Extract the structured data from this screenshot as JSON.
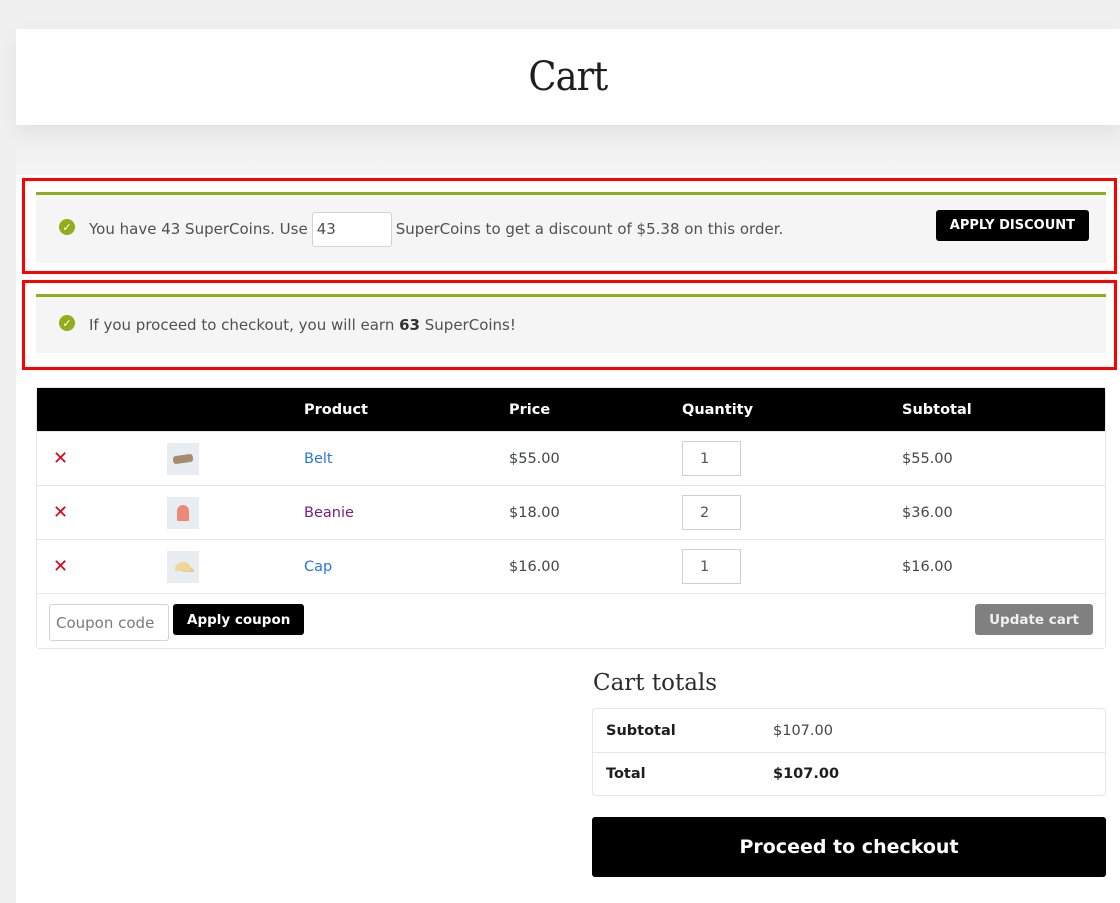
{
  "page": {
    "title": "Cart"
  },
  "supercoins_notice": {
    "text_before": "You have 43 SuperCoins. Use",
    "input_value": "43",
    "text_after": "SuperCoins to get a discount of $5.38 on this order.",
    "apply_label": "APPLY DISCOUNT",
    "icon": "check-circle-icon"
  },
  "earn_notice": {
    "text_before": "If you proceed to checkout, you will earn",
    "amount": "63",
    "text_after": "SuperCoins!",
    "icon": "check-circle-icon"
  },
  "colors": {
    "accent_green": "#8fae1b",
    "highlight_red": "#ff0000",
    "remove_red": "#e2001a",
    "link_blue": "#2a78d3",
    "link_visited": "#7b1c84"
  },
  "cart_table": {
    "headers": [
      "",
      "",
      "Product",
      "Price",
      "Quantity",
      "Subtotal"
    ],
    "rows": [
      {
        "name": "Belt",
        "price": "$55.00",
        "qty": "1",
        "subtotal": "$55.00",
        "thumb": "belt"
      },
      {
        "name": "Beanie",
        "price": "$18.00",
        "qty": "2",
        "subtotal": "$36.00",
        "thumb": "beanie"
      },
      {
        "name": "Cap",
        "price": "$16.00",
        "qty": "1",
        "subtotal": "$16.00",
        "thumb": "cap"
      }
    ],
    "remove_icon": "✕",
    "coupon_placeholder": "Coupon code",
    "apply_coupon_label": "Apply coupon",
    "update_cart_label": "Update cart"
  },
  "cart_totals": {
    "title": "Cart totals",
    "subtotal_label": "Subtotal",
    "subtotal_value": "$107.00",
    "total_label": "Total",
    "total_value": "$107.00",
    "checkout_label": "Proceed to checkout"
  }
}
